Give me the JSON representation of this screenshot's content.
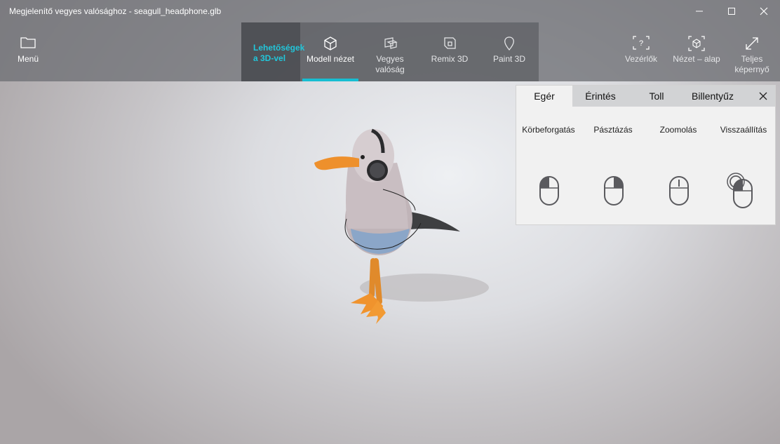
{
  "window": {
    "title": "Megjelenítő vegyes valósághoz - seagull_headphone.glb"
  },
  "toolbar": {
    "menu": {
      "label": "Menü",
      "icon": "folder-icon"
    },
    "get_started": {
      "label": "Lehetőségek a 3D-vel",
      "color": "#22c6da"
    },
    "modes": [
      {
        "label": "Modell nézet",
        "icon": "cube-icon",
        "active": true
      },
      {
        "label": "Vegyes valóság",
        "icon": "mixed-reality-icon",
        "active": false
      },
      {
        "label": "Remix 3D",
        "icon": "remix-3d-icon",
        "active": false
      },
      {
        "label": "Paint 3D",
        "icon": "paint-3d-icon",
        "active": false
      }
    ],
    "controls": {
      "label": "Vezérlők",
      "icon": "help-controls-icon"
    },
    "view_reset": {
      "label": "Nézet – alap",
      "icon": "view-reset-icon"
    },
    "fullscreen": {
      "label": "Teljes képernyő",
      "icon": "fullscreen-icon"
    },
    "accent": "#17bed2"
  },
  "controls_panel": {
    "tabs": [
      {
        "label": "Egér",
        "active": true
      },
      {
        "label": "Érintés",
        "active": false
      },
      {
        "label": "Toll",
        "active": false
      },
      {
        "label": "Billentyűz",
        "active": false
      }
    ],
    "actions": [
      {
        "label": "Körbeforgatás",
        "icon": "mouse-left-button-icon"
      },
      {
        "label": "Pásztázás",
        "icon": "mouse-right-button-icon"
      },
      {
        "label": "Zoomolás",
        "icon": "mouse-scroll-wheel-icon"
      },
      {
        "label": "Visszaállítás",
        "icon": "mouse-double-click-icon"
      }
    ]
  }
}
